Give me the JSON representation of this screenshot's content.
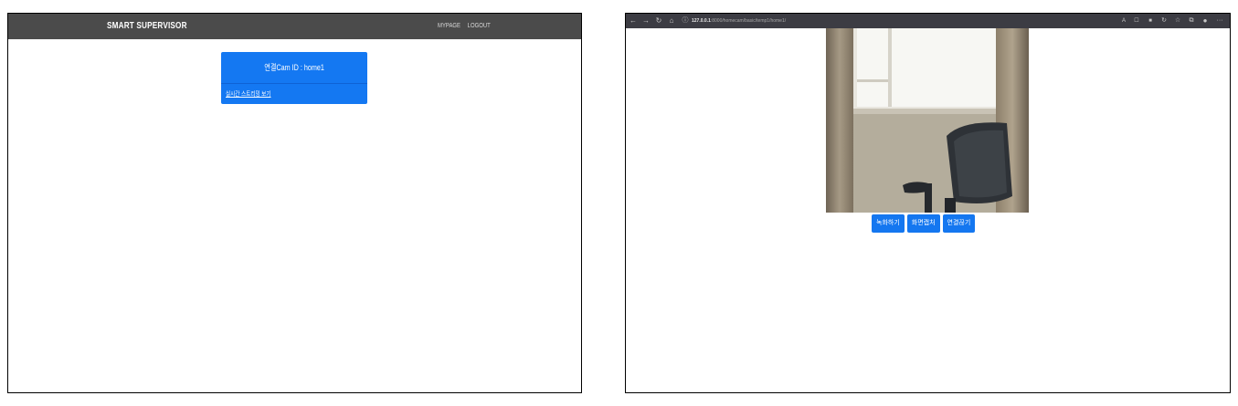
{
  "left_page": {
    "navbar": {
      "brand": "SMART SUPERVISOR",
      "links": [
        "MYPAGE",
        "LOGOUT"
      ]
    },
    "cam_card": {
      "title": "연결Cam ID : home1",
      "link": "실시간 스트리밍 보기"
    },
    "colors": {
      "navbar": "#4b4b4b",
      "card": "#1478f2"
    }
  },
  "right_page": {
    "browser": {
      "address_host": "127.0.0.1",
      "address_path": ":8000/homecam/basic/temp1/home1/",
      "nav_icons": [
        "back-icon",
        "forward-icon",
        "reload-icon",
        "home-icon",
        "info-icon"
      ],
      "toolbar_icons": [
        "read-aloud-icon",
        "translate-icon",
        "extension-icon",
        "refresh-icon",
        "favorites-icon",
        "collections-icon",
        "profile-icon",
        "more-icon"
      ]
    },
    "buttons": [
      "녹화하기",
      "화면캡처",
      "연결끊기"
    ],
    "colors": {
      "button": "#1477f0",
      "browser_bar": "#3c3c43"
    }
  }
}
